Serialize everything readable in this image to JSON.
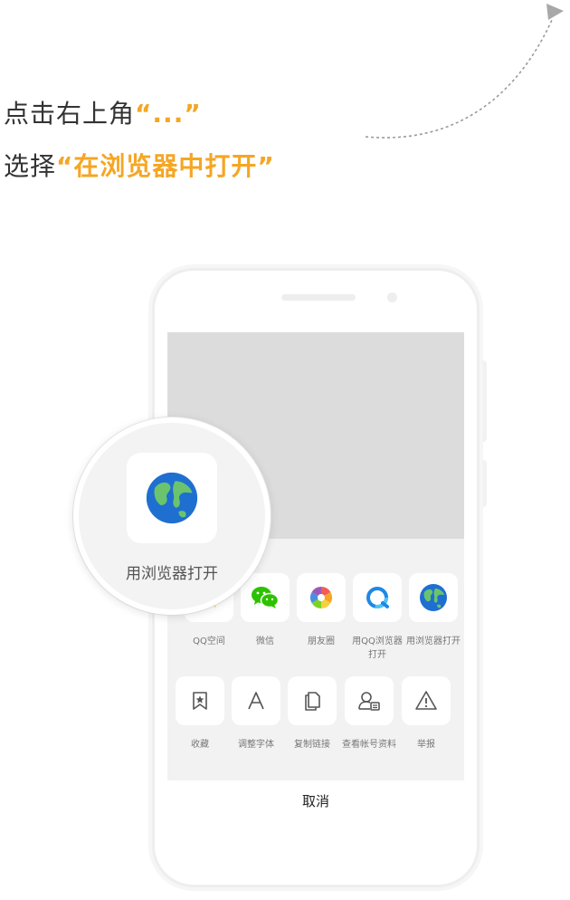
{
  "instructions": {
    "line1_prefix": "点击右上角",
    "line1_highlight": "“...”",
    "line2_prefix": "选择",
    "line2_highlight": "“在浏览器中打开”",
    "highlight_color": "#f5a623"
  },
  "magnifier": {
    "label": "用浏览器打开",
    "icon": "globe-icon"
  },
  "share_row1": [
    {
      "label": "QQ空间",
      "icon": "qzone-icon"
    },
    {
      "label": "微信",
      "icon": "wechat-icon"
    },
    {
      "label": "朋友圈",
      "icon": "moments-icon"
    },
    {
      "label": "用QQ浏览器打开",
      "icon": "qq-browser-icon"
    },
    {
      "label": "用浏览器打开",
      "icon": "globe-icon"
    }
  ],
  "share_row2": [
    {
      "label": "收藏",
      "icon": "bookmark-star-icon"
    },
    {
      "label": "调整字体",
      "icon": "font-icon"
    },
    {
      "label": "复制链接",
      "icon": "copy-icon"
    },
    {
      "label": "查看帐号资料",
      "icon": "profile-card-icon"
    },
    {
      "label": "举报",
      "icon": "warning-icon"
    }
  ],
  "cancel_label": "取消"
}
